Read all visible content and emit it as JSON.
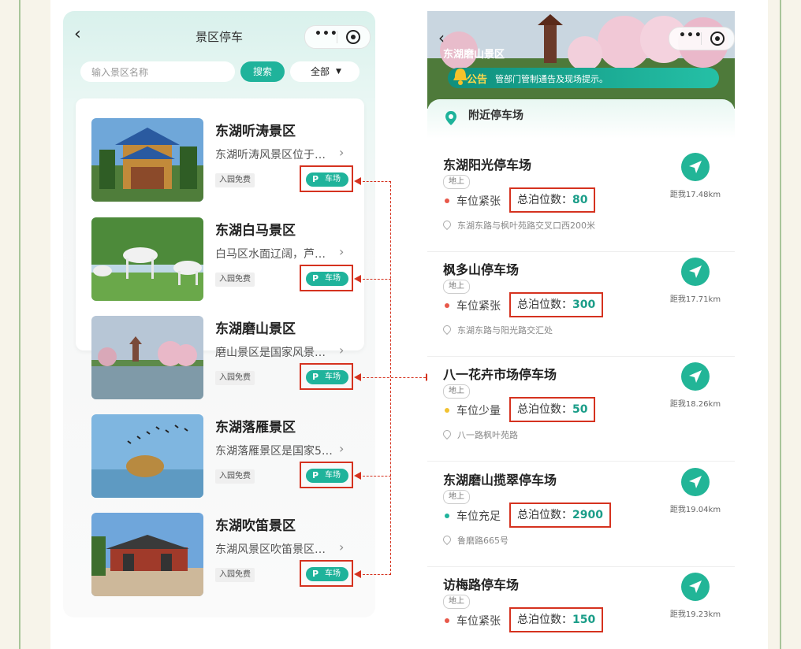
{
  "left_screen": {
    "nav_title": "景区停车",
    "search_placeholder": "输入景区名称",
    "search_button": "搜索",
    "filter_label": "全部",
    "spots": [
      {
        "name": "东湖听涛景区",
        "desc": "东湖听涛风景区位于…",
        "badge": "入园免费",
        "parking_label": "车场",
        "p_icon": "P"
      },
      {
        "name": "东湖白马景区",
        "desc": "白马区水面辽阔，芦…",
        "badge": "入园免费",
        "parking_label": "车场",
        "p_icon": "P"
      },
      {
        "name": "东湖磨山景区",
        "desc": "磨山景区是国家风景…",
        "badge": "入园免费",
        "parking_label": "车场",
        "p_icon": "P"
      },
      {
        "name": "东湖落雁景区",
        "desc": "东湖落雁景区是国家5…",
        "badge": "入园免费",
        "parking_label": "车场",
        "p_icon": "P"
      },
      {
        "name": "东湖吹笛景区",
        "desc": "东湖风景区吹笛景区…",
        "badge": "入园免费",
        "parking_label": "车场",
        "p_icon": "P"
      }
    ]
  },
  "right_screen": {
    "scenic_title": "东湖磨山景区",
    "notice_label": "公告",
    "notice_text": "管部门管制通告及现场提示。",
    "nearby_title": "附近停车场",
    "capacity_label": "总泊位数：",
    "lots": [
      {
        "name": "东湖阳光停车场",
        "tag": "地上",
        "status": "车位紧张",
        "status_color": "#e8584a",
        "capacity": "80",
        "address": "东湖东路与枫叶苑路交叉口西200米",
        "distance": "距我17.48km"
      },
      {
        "name": "枫多山停车场",
        "tag": "地上",
        "status": "车位紧张",
        "status_color": "#e8584a",
        "capacity": "300",
        "address": "东湖东路与阳光路交汇处",
        "distance": "距我17.71km"
      },
      {
        "name": "八一花卉市场停车场",
        "tag": "地上",
        "status": "车位少量",
        "status_color": "#f2c230",
        "capacity": "50",
        "address": "八一路枫叶苑路",
        "distance": "距我18.26km"
      },
      {
        "name": "东湖磨山揽翠停车场",
        "tag": "地上",
        "status": "车位充足",
        "status_color": "#1fb39b",
        "capacity": "2900",
        "address": "鲁磨路665号",
        "distance": "距我19.04km"
      },
      {
        "name": "访梅路停车场",
        "tag": "地上",
        "status": "车位紧张",
        "status_color": "#e8584a",
        "capacity": "150",
        "address": "",
        "distance": "距我19.23km"
      }
    ]
  },
  "colors": {
    "accent": "#1fb39b",
    "highlight": "#d5321f"
  }
}
